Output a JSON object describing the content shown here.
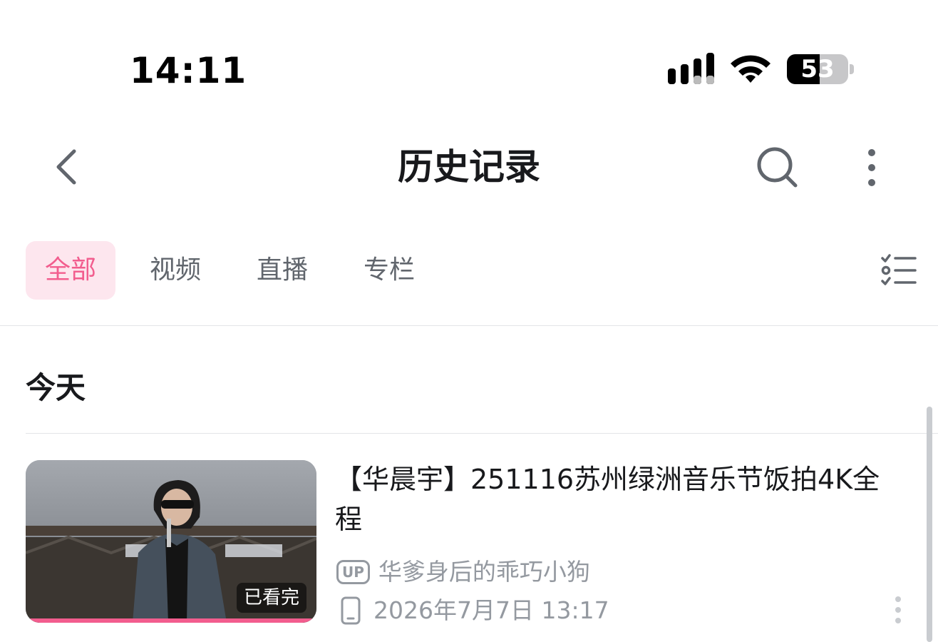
{
  "status_bar": {
    "time": "14:11",
    "battery": "53"
  },
  "header": {
    "title": "历史记录"
  },
  "tabs": [
    {
      "label": "全部",
      "active": true
    },
    {
      "label": "视频",
      "active": false
    },
    {
      "label": "直播",
      "active": false
    },
    {
      "label": "专栏",
      "active": false
    }
  ],
  "section": {
    "label": "今天"
  },
  "items": [
    {
      "title": "【华晨宇】251116苏州绿洲音乐节饭拍4K全程",
      "badge": "已看完",
      "up_badge": "UP",
      "uploader": "华爹身后的乖巧小狗",
      "watched_at": "2026年7月7日 13:17",
      "progress": 1.0
    }
  ],
  "colors": {
    "accent": "#f25d8e",
    "accent_bg": "#fde6ee",
    "text": "#18191c",
    "muted": "#9499a0"
  },
  "icons": [
    "back-icon",
    "search-icon",
    "more-vertical-icon",
    "filter-list-icon",
    "phone-icon",
    "up-badge-icon",
    "signal-icon",
    "wifi-icon",
    "battery-icon"
  ]
}
